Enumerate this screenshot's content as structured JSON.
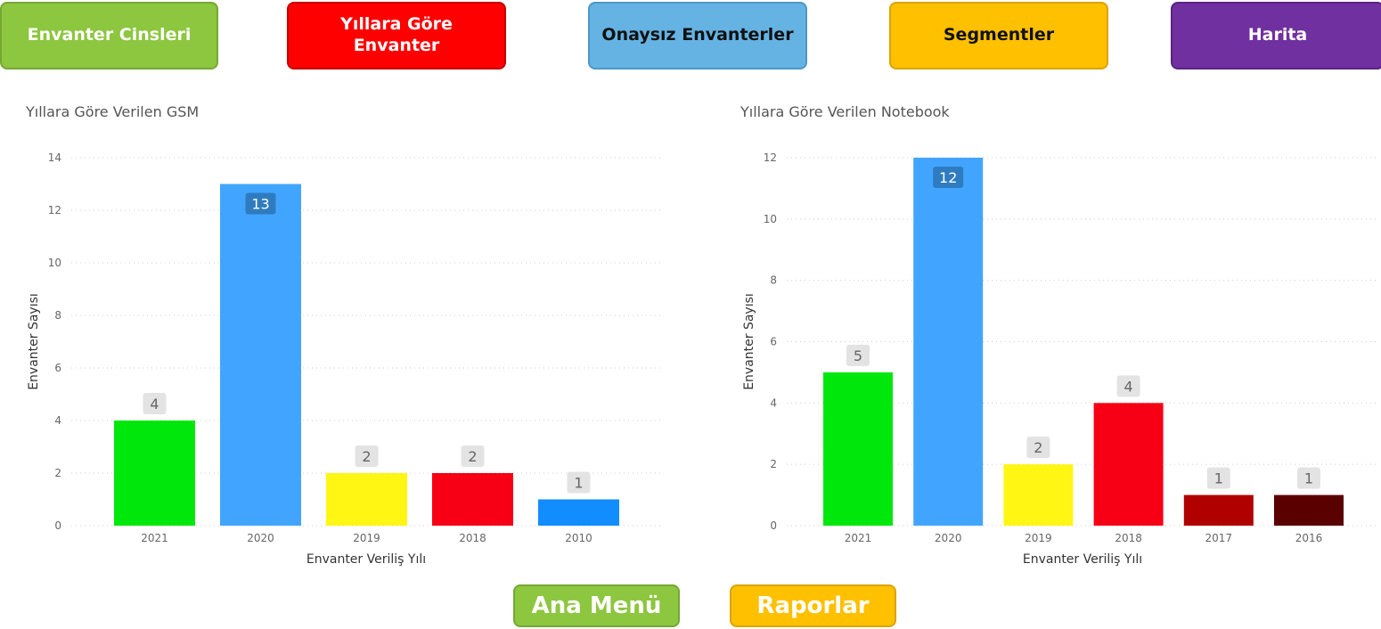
{
  "nav": {
    "envanter_cinsleri": "Envanter Cinsleri",
    "yillara_gore_envanter": "Yıllara Göre Envanter",
    "onaysiz_envanterler": "Onaysız Envanterler",
    "segmentler": "Segmentler",
    "harita": "Harita"
  },
  "footer": {
    "ana_menu": "Ana Menü",
    "raporlar": "Raporlar"
  },
  "chart_data": [
    {
      "type": "bar",
      "title": "Yıllara Göre Verilen GSM",
      "xlabel": "Envanter Veriliş Yılı",
      "ylabel": "Envanter Sayısı",
      "categories": [
        "2021",
        "2020",
        "2019",
        "2018",
        "2010"
      ],
      "values": [
        4,
        13,
        2,
        2,
        1
      ],
      "colors": [
        "#00e80b",
        "#41a5ff",
        "#fff614",
        "#f70015",
        "#118dff"
      ],
      "ylim": [
        0,
        14
      ],
      "yticks": [
        0,
        2,
        4,
        6,
        8,
        10,
        12,
        14
      ],
      "grid": true,
      "legend": false
    },
    {
      "type": "bar",
      "title": "Yıllara Göre Verilen Notebook",
      "xlabel": "Envanter Veriliş Yılı",
      "ylabel": "Envanter Sayısı",
      "categories": [
        "2021",
        "2020",
        "2019",
        "2018",
        "2017",
        "2016"
      ],
      "values": [
        5,
        12,
        2,
        4,
        1,
        1
      ],
      "colors": [
        "#00e80b",
        "#41a5ff",
        "#fff614",
        "#f70015",
        "#b10000",
        "#5a0000"
      ],
      "ylim": [
        0,
        12
      ],
      "yticks": [
        0,
        2,
        4,
        6,
        8,
        10,
        12
      ],
      "grid": true,
      "legend": false
    }
  ]
}
